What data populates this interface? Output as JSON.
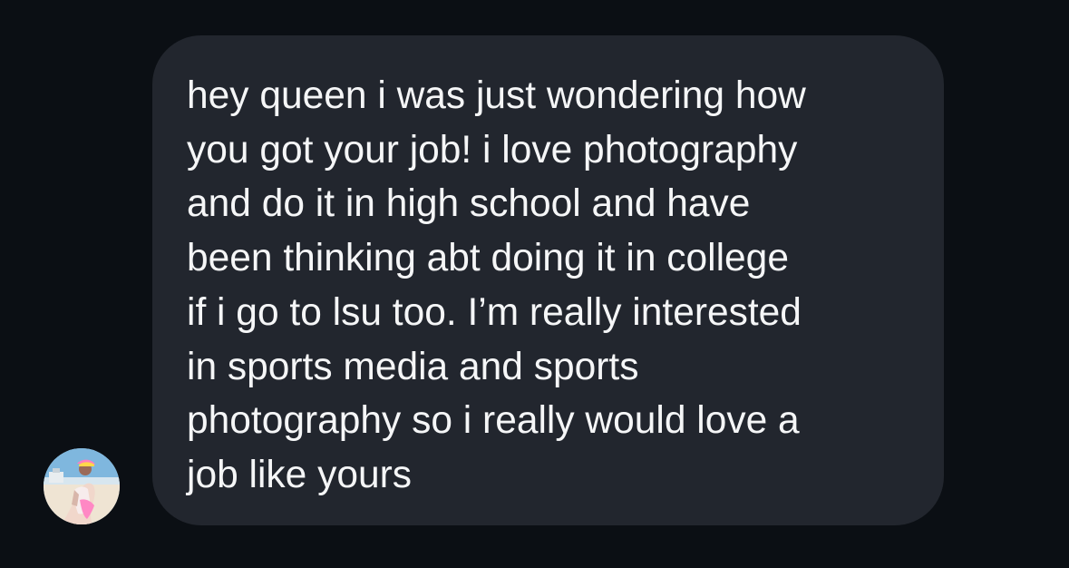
{
  "colors": {
    "background": "#0b0f14",
    "bubble": "#22262e",
    "text": "#f5f6f7"
  },
  "sender": {
    "avatar_icon": "profile-photo-avatar"
  },
  "message": {
    "lines": [
      "hey queen i was just wondering how",
      "you got your job! i love photography",
      "and do it in high school and have",
      "been thinking abt doing it in college",
      "if i go to lsu too. I’m really interested",
      "in sports media and sports",
      "photography so i really would love a",
      "job like yours"
    ]
  }
}
